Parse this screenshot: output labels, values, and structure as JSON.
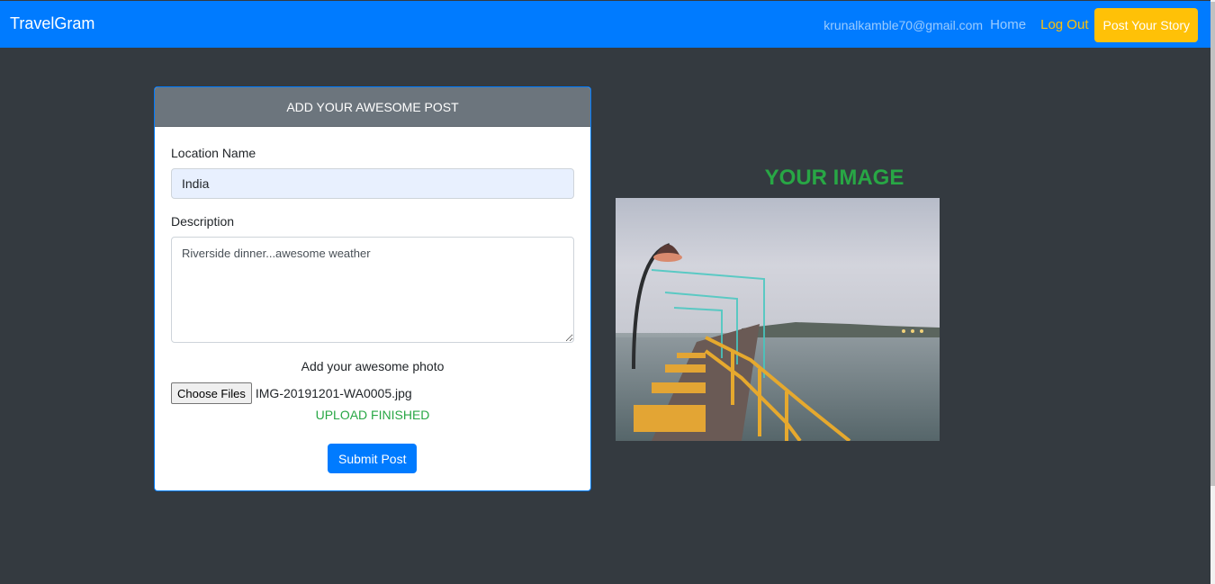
{
  "navbar": {
    "brand": "TravelGram",
    "email": "krunalkamble70@gmail.com",
    "home_label": "Home",
    "logout_label": "Log Out",
    "post_story_label": "Post Your Story"
  },
  "form": {
    "header": "ADD YOUR AWESOME POST",
    "location_label": "Location Name",
    "location_value": "India",
    "description_label": "Description",
    "description_value": "Riverside dinner...awesome weather",
    "photo_label": "Add your awesome photo",
    "choose_files_label": "Choose Files",
    "file_name": "IMG-20191201-WA0005.jpg",
    "upload_status": "UPLOAD FINISHED",
    "submit_label": "Submit Post"
  },
  "preview": {
    "title": "YOUR IMAGE"
  },
  "colors": {
    "navbar": "#007bff",
    "page_background": "#343a40",
    "accent_yellow": "#ffc107",
    "success_green": "#28a745",
    "card_header": "#6c757d"
  }
}
